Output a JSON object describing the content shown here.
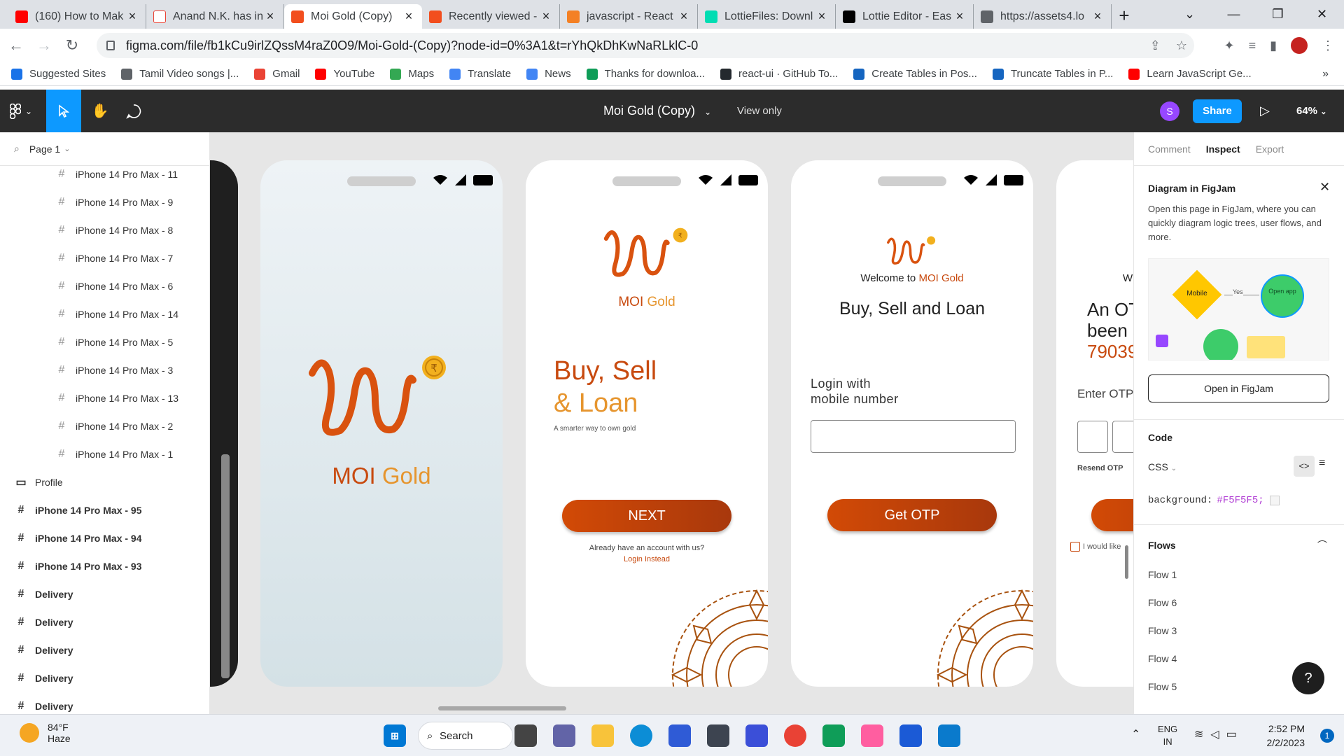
{
  "browser": {
    "tabs": [
      {
        "title": "(160) How to Mak",
        "fav_color": "#ff0000",
        "fav": "yt",
        "active": false
      },
      {
        "title": "Anand N.K. has in",
        "fav_color": "#ffffff",
        "fav": "gmail",
        "active": false
      },
      {
        "title": "Moi Gold (Copy)",
        "fav_color": "#f24e1e",
        "fav": "figma",
        "active": true
      },
      {
        "title": "Recently viewed -",
        "fav_color": "#f24e1e",
        "fav": "figma",
        "active": false
      },
      {
        "title": "javascript - React",
        "fav_color": "#f48024",
        "fav": "so",
        "active": false
      },
      {
        "title": "LottieFiles: Downl",
        "fav_color": "#00ddb3",
        "fav": "lottie",
        "active": false
      },
      {
        "title": "Lottie Editor - Eas",
        "fav_color": "#000000",
        "fav": "lottie-edit",
        "active": false
      },
      {
        "title": "https://assets4.lo",
        "fav_color": "#5f6368",
        "fav": "globe",
        "active": false
      }
    ],
    "url": "figma.com/file/fb1kCu9irlZQssM4raZ0O9/Moi-Gold-(Copy)?node-id=0%3A1&t=rYhQkDhKwNaRLklC-0",
    "bookmarks": [
      {
        "label": "Suggested Sites",
        "color": "#1a73e8"
      },
      {
        "label": "Tamil Video songs |...",
        "color": "#5f6368"
      },
      {
        "label": "Gmail",
        "color": "#ea4335"
      },
      {
        "label": "YouTube",
        "color": "#ff0000"
      },
      {
        "label": "Maps",
        "color": "#34a853"
      },
      {
        "label": "Translate",
        "color": "#4285f4"
      },
      {
        "label": "News",
        "color": "#4285f4"
      },
      {
        "label": "Thanks for downloa...",
        "color": "#0f9d58"
      },
      {
        "label": "react-ui · GitHub To...",
        "color": "#24292e"
      },
      {
        "label": "Create Tables in Pos...",
        "color": "#1565c0"
      },
      {
        "label": "Truncate Tables in P...",
        "color": "#1565c0"
      },
      {
        "label": "Learn JavaScript Ge...",
        "color": "#ff0000"
      }
    ],
    "more": "»"
  },
  "figma": {
    "file_title": "Moi Gold (Copy)",
    "view_only": "View only",
    "user_initial": "S",
    "share": "Share",
    "zoom": "64%",
    "page": "Page 1",
    "layers_indented": [
      "iPhone 14 Pro Max - 11",
      "iPhone 14 Pro Max - 9",
      "iPhone 14 Pro Max - 8",
      "iPhone 14 Pro Max - 7",
      "iPhone 14 Pro Max - 6",
      "iPhone 14 Pro Max - 14",
      "iPhone 14 Pro Max - 5",
      "iPhone 14 Pro Max - 3",
      "iPhone 14 Pro Max - 13",
      "iPhone 14 Pro Max - 2",
      "iPhone 14 Pro Max - 1"
    ],
    "layers_top": [
      {
        "label": "Profile",
        "icon": "frame-icon"
      },
      {
        "label": "iPhone 14 Pro Max - 95",
        "icon": "hash-icon"
      },
      {
        "label": "iPhone 14 Pro Max - 94",
        "icon": "hash-icon"
      },
      {
        "label": "iPhone 14 Pro Max - 93",
        "icon": "hash-icon"
      },
      {
        "label": "Delivery",
        "icon": "hash-icon"
      },
      {
        "label": "Delivery",
        "icon": "hash-icon"
      },
      {
        "label": "Delivery",
        "icon": "hash-icon"
      },
      {
        "label": "Delivery",
        "icon": "hash-icon"
      },
      {
        "label": "Delivery",
        "icon": "hash-icon"
      }
    ]
  },
  "screens": {
    "splash": {
      "brand_moi": "MOI",
      "brand_gold": "Gold"
    },
    "intro": {
      "brand_moi": "MOI",
      "brand_gold": "Gold",
      "headline1": "Buy, Sell",
      "headline2": "& Loan",
      "tagline": "A smarter way to own gold",
      "next": "NEXT",
      "already": "Already have an account with us?",
      "login": "Login Instead"
    },
    "login": {
      "welcome": "Welcome to",
      "brand": "MOI Gold",
      "title": "Buy, Sell and Loan",
      "label1": "Login with",
      "label2": "mobile number",
      "phone_value": "",
      "get_otp": "Get OTP"
    },
    "otp": {
      "welcome_partial": "W",
      "line1": "An OT",
      "line2": "been s",
      "number": "79039",
      "enter": "Enter OTP",
      "resend": "Resend OTP",
      "check": "I would like"
    }
  },
  "inspect": {
    "tabs": [
      "Comment",
      "Inspect",
      "Export"
    ],
    "active_tab": "Inspect",
    "diagram_title": "Diagram in FigJam",
    "diagram_desc": "Open this page in FigJam, where you can quickly diagram logic trees, user flows, and more.",
    "preview_mobile": "Mobile",
    "preview_yes": "Yes",
    "preview_open": "Open app",
    "open_btn": "Open in FigJam",
    "code_title": "Code",
    "lang": "CSS",
    "code_prop": "background:",
    "code_val": "#F5F5F5;",
    "flows_title": "Flows",
    "flows": [
      "Flow 1",
      "Flow 6",
      "Flow 3",
      "Flow 4",
      "Flow 5"
    ],
    "help": "?"
  },
  "taskbar": {
    "temp": "84°F",
    "cond": "Haze",
    "search": "Search",
    "lang1": "ENG",
    "lang2": "IN",
    "time": "2:52 PM",
    "date": "2/2/2023",
    "notif": "1"
  },
  "colors": {
    "accent": "#0d99ff",
    "brand_orange": "#c84a0f",
    "brand_gold": "#e6952e",
    "figma_dark": "#2c2c2c"
  }
}
